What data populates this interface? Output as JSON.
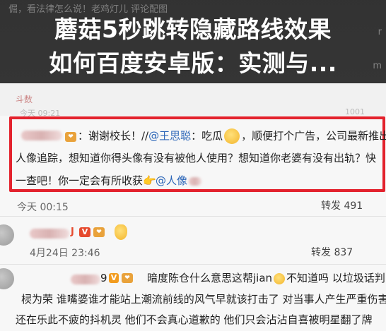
{
  "overlay": {
    "bg_text": "倔，看法律怎么说！老鸡灯儿  评论配图",
    "title_line1": "蘑菇5秒跳转隐藏路线效果",
    "title_line2": "如何百度安卓版：实测与...",
    "ghost_right_1": "r",
    "ghost_right_2": "m"
  },
  "header": {
    "tab_label": "斗数",
    "ghost_left": "今天 09:21",
    "ghost_right": "1001"
  },
  "comments": [
    {
      "line1_prefix": "：谢谢校长！//",
      "line1_mention": "@王思聪",
      "line1_suffix": "：吃瓜",
      "line1_rest": "，顺便打个广告，公司最新推出",
      "line2": "人像追踪，想知道你得头像有没有被他人使用？想知道你老婆有没有出轨？快",
      "line3_prefix": "一查吧！你一定会有所收获",
      "line3_mention": "@人像",
      "time": "今天 00:15",
      "repost": "转发 491"
    },
    {
      "name_suffix": "J",
      "time": "4月24日 23:46",
      "repost": "转发 837"
    },
    {
      "line1_badge": "9",
      "line1_text": "暗度陈仓什么意思这帮jian",
      "line1_text2": "不知道吗 以垃圾话判",
      "line2": "棂为荣 谁嘴婆谁才能站上潮流前线的风气早就该打击了 对当事人产生严重伤害",
      "line3": "还在乐此不疲的抖机灵 他们不会真心道歉的 他们只会沾沾自喜被明星翻了牌"
    }
  ],
  "icons": {
    "vip_badge": "vip-badge-icon",
    "v_badge": "verified-badge-icon",
    "emoji_eat": "eat-melon-emoji-icon",
    "emoji_point": "point-hand-emoji-icon"
  },
  "colors": {
    "highlight": "#e3222d",
    "mention": "#2c66b8"
  }
}
